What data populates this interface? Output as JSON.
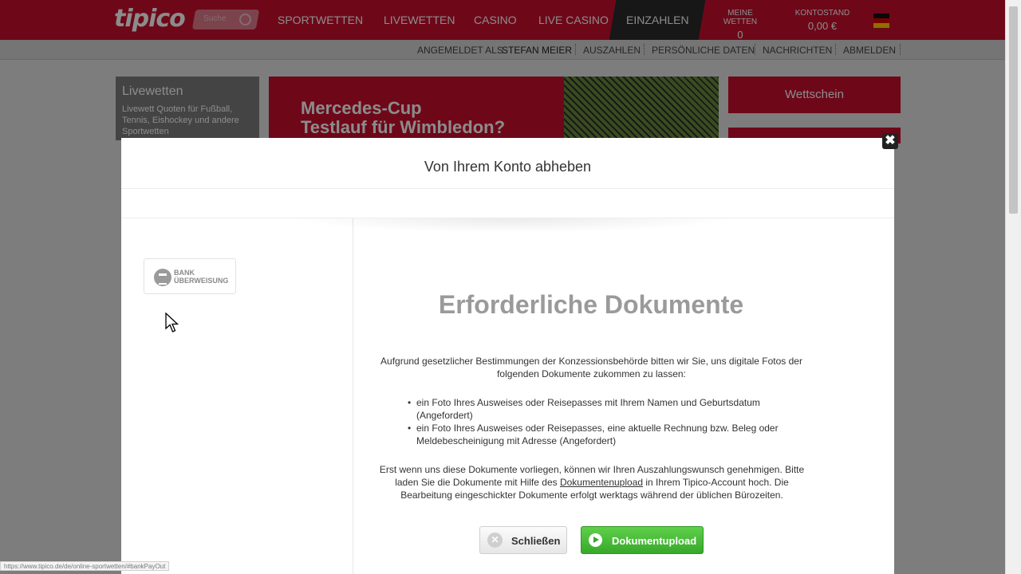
{
  "nav": {
    "logo": "tipico",
    "search_placeholder": "Suche",
    "items": [
      "SPORTWETTEN",
      "LIVEWETTEN",
      "CASINO",
      "LIVE CASINO",
      "EINZAHLEN"
    ],
    "meine_wetten_label": "MEINE WETTEN",
    "meine_wetten_value": "0",
    "kontostand_label": "KONTOSTAND",
    "kontostand_value": "0,00 €"
  },
  "subnav": {
    "logged_in_label": "ANGEMELDET ALS",
    "username": "STEFAN MEIER",
    "items": [
      "AUSZAHLEN",
      "PERSÖNLICHE DATEN",
      "NACHRICHTEN",
      "ABMELDEN"
    ]
  },
  "background": {
    "live_title": "Livewetten",
    "live_text": "Livewett Quoten für Fußball, Tennis, Eishockey und andere Sportwetten",
    "banner_line1": "Mercedes-Cup",
    "banner_line2": "Testlauf für Wimbledon?",
    "wettschein": "Wettschein"
  },
  "modal": {
    "title": "Von Ihrem Konto abheben",
    "close_glyph": "✖",
    "payment_method_line1": "BANK",
    "payment_method_line2": "ÜBERWEISUNG",
    "heading": "Erforderliche Dokumente",
    "intro": "Aufgrund gesetzlicher Bestimmungen der Konzessionsbehörde bitten wir Sie, uns digitale Fotos der folgenden Dokumente zukommen zu lassen:",
    "documents": [
      "ein Foto Ihres Ausweises oder Reisepasses mit Ihrem Namen und Geburtsdatum (Angefordert)",
      "ein Foto Ihres Ausweises oder Reisepasses, eine aktuelle Rechnung bzw. Beleg oder Meldebescheinigung mit Adresse (Angefordert)"
    ],
    "outro_part1": "Erst wenn uns diese Dokumente vorliegen, können wir Ihren Auszahlungswunsch genehmigen. Bitte laden Sie die Dokumente mit Hilfe des ",
    "outro_link": "Dokumentenupload",
    "outro_part2": " in Ihrem Tipico-Account hoch. Die Bearbeitung eingeschickter Dokumente erfolgt werktags während der üblichen Bürozeiten.",
    "close_button": "Schließen",
    "upload_button": "Dokumentupload"
  },
  "status_bar": {
    "url": "https://www.tipico.de/de/online-sportwetten/#bankPayOut"
  },
  "colors": {
    "brand_red": "#c8102e",
    "upload_green": "#37a82a"
  }
}
